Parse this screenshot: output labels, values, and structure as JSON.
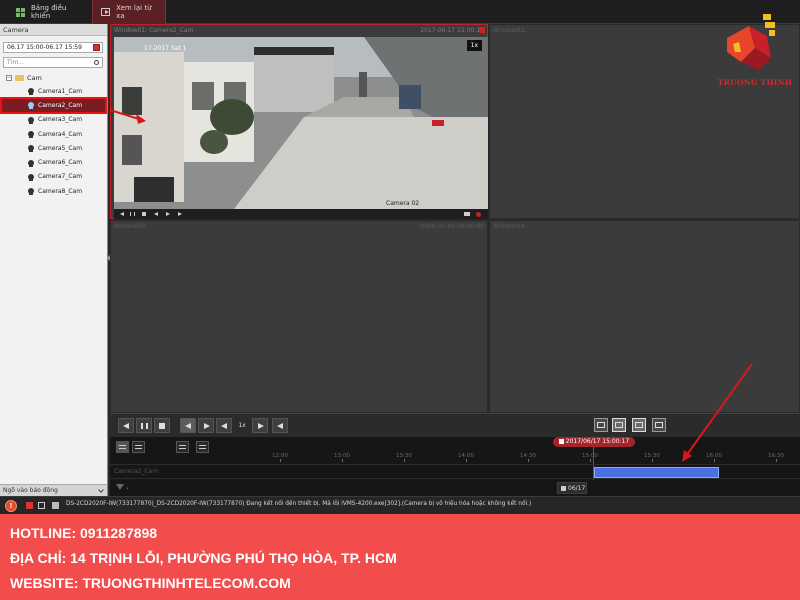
{
  "tabs": [
    {
      "label": "Bảng điều khiển",
      "icon": "grid-icon"
    },
    {
      "label": "Xem lại từ xa",
      "icon": "playback-icon"
    }
  ],
  "sidebar": {
    "header": "Camera",
    "date_range": "06.17 15:00-06.17 15:59",
    "search_placeholder": "Tìm...",
    "root_label": "Cam",
    "items": [
      {
        "label": "Camera1_Cam"
      },
      {
        "label": "Camera2_Cam",
        "selected": true
      },
      {
        "label": "Camera3_Cam"
      },
      {
        "label": "Camera4_Cam"
      },
      {
        "label": "Camera5_Cam"
      },
      {
        "label": "Camera6_Cam"
      },
      {
        "label": "Camera7_Cam"
      },
      {
        "label": "Camera8_Cam"
      }
    ],
    "alarm_input_label": "Ngõ vào báo động"
  },
  "windows": {
    "w1": {
      "label": "Window01: Camera2_Cam",
      "timestamp": "2017-06-17 15:00:17",
      "speed": "1x",
      "overlay_date": "17-2017 Sat 1",
      "overlay_name": "Camera 02"
    },
    "w2": {
      "label": "Window02:"
    },
    "w3": {
      "label": "Window03:",
      "timestamp": "0000-00-00 00:00:00"
    },
    "w4": {
      "label": "Window04:"
    }
  },
  "toolbar": {
    "speed": "1x"
  },
  "timeline": {
    "cursor_time": "2017/06/17 15:00:17",
    "ticks": [
      "12:00",
      "13:00",
      "13:30",
      "14:00",
      "14:30",
      "15:00",
      "15:30",
      "16:00",
      "16:30"
    ],
    "track_label": "Camera2_Cam",
    "date_label": "06/17",
    "recording_color": "#4a6fe0"
  },
  "status": {
    "message": "DS-2CD2020F-IW(733177870)_DS-2CD2020F-IW(733177870) Đang kết nối đến thiết bị. Mã lỗi iVMS-4200.exe[302].(Camera bị vô hiệu hóa hoặc không kết nối.)"
  },
  "banner": {
    "hotline": "HOTLINE: 0911287898",
    "address": "ĐỊA CHỈ: 14 TRỊNH LỖI, PHƯỜNG PHÚ THỌ HÒA, TP. HCM",
    "website": "WEBSITE: TRUONGTHINHTELECOM.COM"
  },
  "logo": {
    "text": "TRUONG THINH",
    "color_red": "#d42a2a",
    "color_gold": "#f0c020"
  },
  "colors": {
    "accent": "#c52028",
    "banner": "#f34c4c",
    "arrow": "#d81818"
  }
}
